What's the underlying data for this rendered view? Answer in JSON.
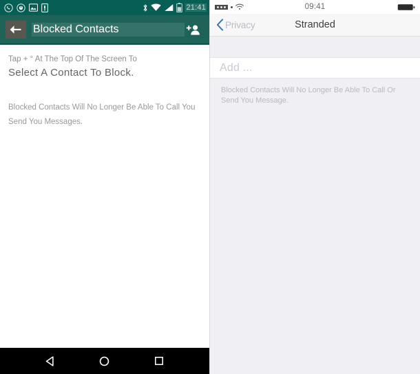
{
  "android": {
    "statusbar": {
      "notification_icons": [
        "whatsapp-icon",
        "clock-icon",
        "photo-icon",
        "sim-card-icon"
      ],
      "system_icons": [
        "bluetooth-icon",
        "wifi-icon",
        "signal-icon",
        "battery-icon"
      ],
      "time": "21:41"
    },
    "appbar": {
      "back_icon": "back-arrow-icon",
      "title": "Blocked Contacts",
      "action_icon": "add-contact-icon"
    },
    "body": {
      "hint_line1": "Tap + ° At The Top Of The Screen To",
      "hint_line2": "Select A Contact To Block.",
      "description": "Blocked Contacts Will No Longer Be Able To Call You Send You Messages."
    },
    "navbar": {
      "back": "back-triangle-icon",
      "home": "home-circle-icon",
      "recents": "recents-square-icon"
    }
  },
  "ios": {
    "statusbar": {
      "signal_icon": "signal-dots-icon",
      "wifi_icon": "wifi-icon",
      "time": "09:41",
      "battery_icon": "battery-icon"
    },
    "navbar": {
      "back_icon": "chevron-left-icon",
      "back_label": "Privacy",
      "title": "Stranded"
    },
    "list": {
      "add_row_label": "Add ..."
    },
    "footer": {
      "description": "Blocked Contacts Will No Longer Be Able To Call Or Send You Message."
    }
  },
  "colors": {
    "android_statusbar": "#075E54",
    "android_appbar": "#1F6257",
    "ios_background": "#EFEFF4",
    "ios_navbar": "#F7F7F8",
    "ios_accent": "#2f6fb5"
  }
}
